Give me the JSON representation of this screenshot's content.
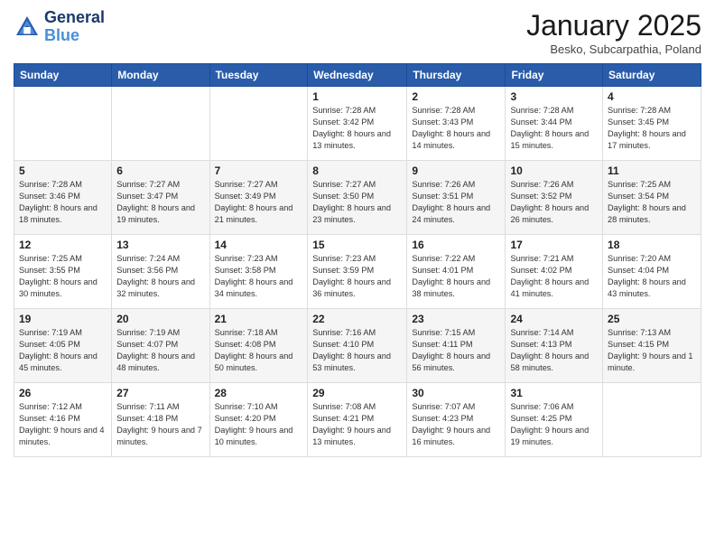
{
  "header": {
    "logo_line1": "General",
    "logo_line2": "Blue",
    "month": "January 2025",
    "location": "Besko, Subcarpathia, Poland"
  },
  "days_of_week": [
    "Sunday",
    "Monday",
    "Tuesday",
    "Wednesday",
    "Thursday",
    "Friday",
    "Saturday"
  ],
  "weeks": [
    [
      {
        "day": "",
        "info": ""
      },
      {
        "day": "",
        "info": ""
      },
      {
        "day": "",
        "info": ""
      },
      {
        "day": "1",
        "info": "Sunrise: 7:28 AM\nSunset: 3:42 PM\nDaylight: 8 hours\nand 13 minutes."
      },
      {
        "day": "2",
        "info": "Sunrise: 7:28 AM\nSunset: 3:43 PM\nDaylight: 8 hours\nand 14 minutes."
      },
      {
        "day": "3",
        "info": "Sunrise: 7:28 AM\nSunset: 3:44 PM\nDaylight: 8 hours\nand 15 minutes."
      },
      {
        "day": "4",
        "info": "Sunrise: 7:28 AM\nSunset: 3:45 PM\nDaylight: 8 hours\nand 17 minutes."
      }
    ],
    [
      {
        "day": "5",
        "info": "Sunrise: 7:28 AM\nSunset: 3:46 PM\nDaylight: 8 hours\nand 18 minutes."
      },
      {
        "day": "6",
        "info": "Sunrise: 7:27 AM\nSunset: 3:47 PM\nDaylight: 8 hours\nand 19 minutes."
      },
      {
        "day": "7",
        "info": "Sunrise: 7:27 AM\nSunset: 3:49 PM\nDaylight: 8 hours\nand 21 minutes."
      },
      {
        "day": "8",
        "info": "Sunrise: 7:27 AM\nSunset: 3:50 PM\nDaylight: 8 hours\nand 23 minutes."
      },
      {
        "day": "9",
        "info": "Sunrise: 7:26 AM\nSunset: 3:51 PM\nDaylight: 8 hours\nand 24 minutes."
      },
      {
        "day": "10",
        "info": "Sunrise: 7:26 AM\nSunset: 3:52 PM\nDaylight: 8 hours\nand 26 minutes."
      },
      {
        "day": "11",
        "info": "Sunrise: 7:25 AM\nSunset: 3:54 PM\nDaylight: 8 hours\nand 28 minutes."
      }
    ],
    [
      {
        "day": "12",
        "info": "Sunrise: 7:25 AM\nSunset: 3:55 PM\nDaylight: 8 hours\nand 30 minutes."
      },
      {
        "day": "13",
        "info": "Sunrise: 7:24 AM\nSunset: 3:56 PM\nDaylight: 8 hours\nand 32 minutes."
      },
      {
        "day": "14",
        "info": "Sunrise: 7:23 AM\nSunset: 3:58 PM\nDaylight: 8 hours\nand 34 minutes."
      },
      {
        "day": "15",
        "info": "Sunrise: 7:23 AM\nSunset: 3:59 PM\nDaylight: 8 hours\nand 36 minutes."
      },
      {
        "day": "16",
        "info": "Sunrise: 7:22 AM\nSunset: 4:01 PM\nDaylight: 8 hours\nand 38 minutes."
      },
      {
        "day": "17",
        "info": "Sunrise: 7:21 AM\nSunset: 4:02 PM\nDaylight: 8 hours\nand 41 minutes."
      },
      {
        "day": "18",
        "info": "Sunrise: 7:20 AM\nSunset: 4:04 PM\nDaylight: 8 hours\nand 43 minutes."
      }
    ],
    [
      {
        "day": "19",
        "info": "Sunrise: 7:19 AM\nSunset: 4:05 PM\nDaylight: 8 hours\nand 45 minutes."
      },
      {
        "day": "20",
        "info": "Sunrise: 7:19 AM\nSunset: 4:07 PM\nDaylight: 8 hours\nand 48 minutes."
      },
      {
        "day": "21",
        "info": "Sunrise: 7:18 AM\nSunset: 4:08 PM\nDaylight: 8 hours\nand 50 minutes."
      },
      {
        "day": "22",
        "info": "Sunrise: 7:16 AM\nSunset: 4:10 PM\nDaylight: 8 hours\nand 53 minutes."
      },
      {
        "day": "23",
        "info": "Sunrise: 7:15 AM\nSunset: 4:11 PM\nDaylight: 8 hours\nand 56 minutes."
      },
      {
        "day": "24",
        "info": "Sunrise: 7:14 AM\nSunset: 4:13 PM\nDaylight: 8 hours\nand 58 minutes."
      },
      {
        "day": "25",
        "info": "Sunrise: 7:13 AM\nSunset: 4:15 PM\nDaylight: 9 hours\nand 1 minute."
      }
    ],
    [
      {
        "day": "26",
        "info": "Sunrise: 7:12 AM\nSunset: 4:16 PM\nDaylight: 9 hours\nand 4 minutes."
      },
      {
        "day": "27",
        "info": "Sunrise: 7:11 AM\nSunset: 4:18 PM\nDaylight: 9 hours\nand 7 minutes."
      },
      {
        "day": "28",
        "info": "Sunrise: 7:10 AM\nSunset: 4:20 PM\nDaylight: 9 hours\nand 10 minutes."
      },
      {
        "day": "29",
        "info": "Sunrise: 7:08 AM\nSunset: 4:21 PM\nDaylight: 9 hours\nand 13 minutes."
      },
      {
        "day": "30",
        "info": "Sunrise: 7:07 AM\nSunset: 4:23 PM\nDaylight: 9 hours\nand 16 minutes."
      },
      {
        "day": "31",
        "info": "Sunrise: 7:06 AM\nSunset: 4:25 PM\nDaylight: 9 hours\nand 19 minutes."
      },
      {
        "day": "",
        "info": ""
      }
    ]
  ]
}
